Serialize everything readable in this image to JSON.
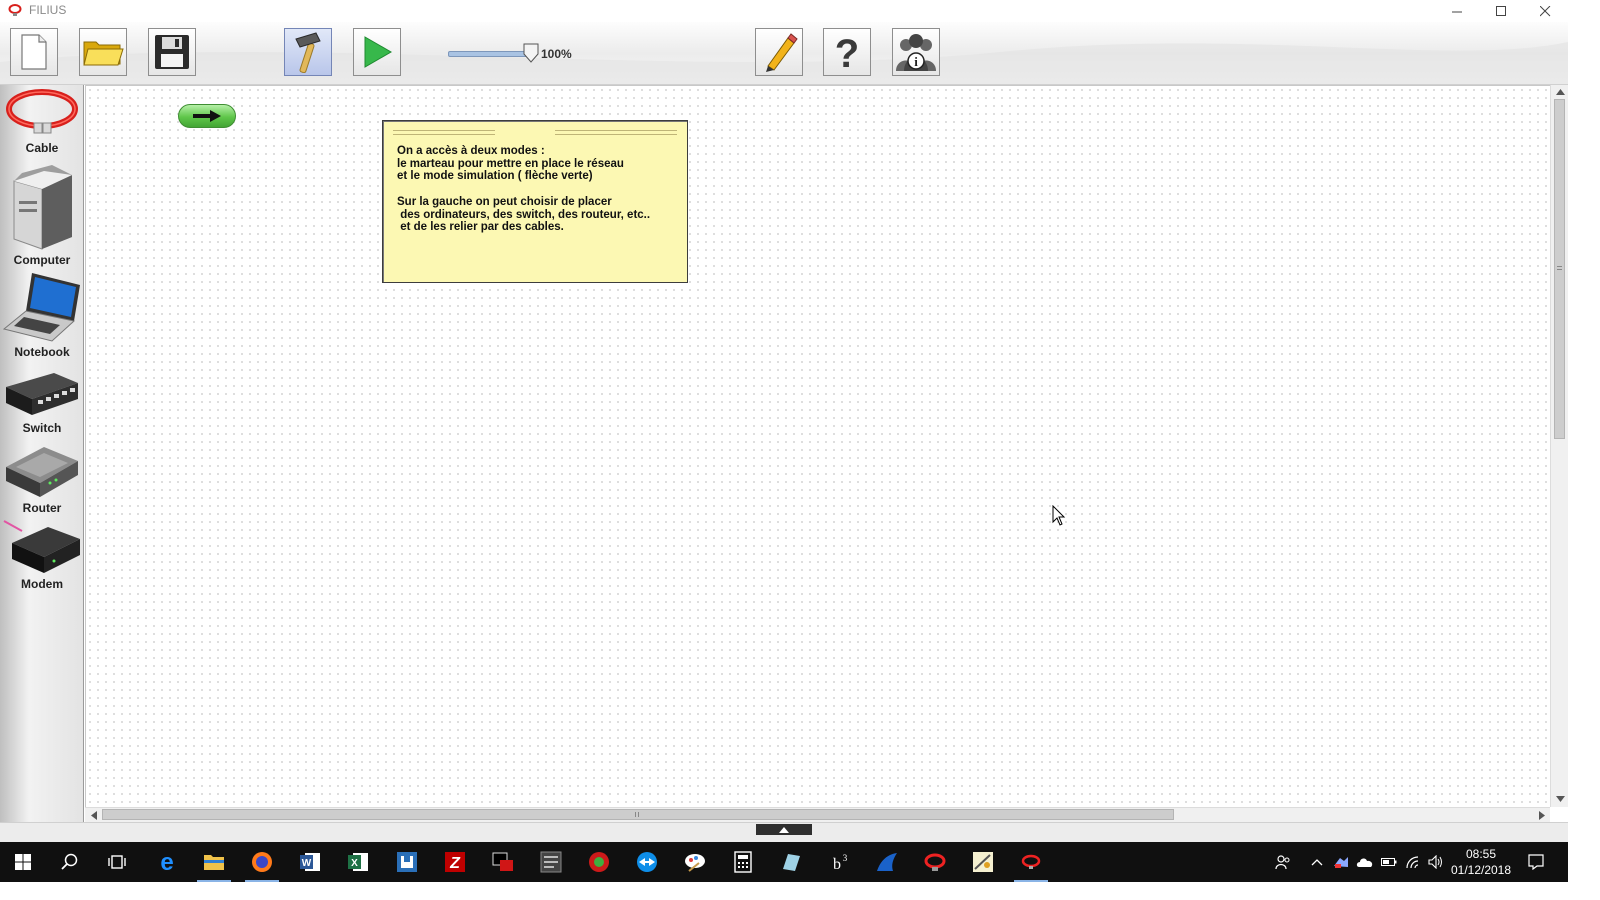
{
  "window": {
    "title": "FILIUS"
  },
  "colors": {
    "note_bg": "#fcf8b3",
    "mode_green": "#5fc64a",
    "cable_red": "#d8201c",
    "taskbar": "#101010"
  },
  "toolbar": {
    "buttons": [
      {
        "icon": "new-file-icon"
      },
      {
        "icon": "open-folder-icon"
      },
      {
        "icon": "save-disk-icon"
      },
      {
        "icon": "hammer-icon",
        "active": true
      },
      {
        "icon": "play-icon"
      },
      {
        "icon": "pencil-icon"
      },
      {
        "icon": "help-icon"
      },
      {
        "icon": "info-people-icon"
      }
    ],
    "zoom": {
      "label": "100%",
      "value_percent": 100
    }
  },
  "palette": {
    "items": [
      {
        "label": "Cable",
        "icon": "cable-icon"
      },
      {
        "label": "Computer",
        "icon": "computer-icon"
      },
      {
        "label": "Notebook",
        "icon": "notebook-icon"
      },
      {
        "label": "Switch",
        "icon": "switch-icon"
      },
      {
        "label": "Router",
        "icon": "router-icon"
      },
      {
        "label": "Modem",
        "icon": "modem-icon"
      }
    ]
  },
  "canvas": {
    "note": {
      "text": "On a accès à deux modes :\nle marteau pour mettre en place le réseau\net le mode simulation ( flèche verte)\n\nSur la gauche on peut choisir de placer\n des ordinateurs, des switch, des routeur, etc..\n et de les relier par des cables."
    }
  },
  "taskbar": {
    "apps": [
      "windows-start-icon",
      "search-icon",
      "task-view-icon",
      "edge-icon",
      "file-explorer-icon",
      "firefox-icon",
      "word-icon",
      "excel-icon",
      "app-window-icon",
      "filezilla-icon",
      "terminal-icon",
      "latex-icon",
      "greenfoot-icon",
      "teamviewer-icon",
      "paint-icon",
      "calculator-icon",
      "app-note-icon",
      "app-b3-icon",
      "shark-icon",
      "filius-red-icon",
      "geogebra-icon",
      "filius-active-icon"
    ],
    "tray_icons": [
      "people-icon",
      "chevron-up-icon",
      "tray-app-icon",
      "onedrive-icon",
      "battery-icon",
      "wifi-icon",
      "volume-icon"
    ],
    "clock": {
      "time": "08:55",
      "date": "01/12/2018"
    }
  }
}
